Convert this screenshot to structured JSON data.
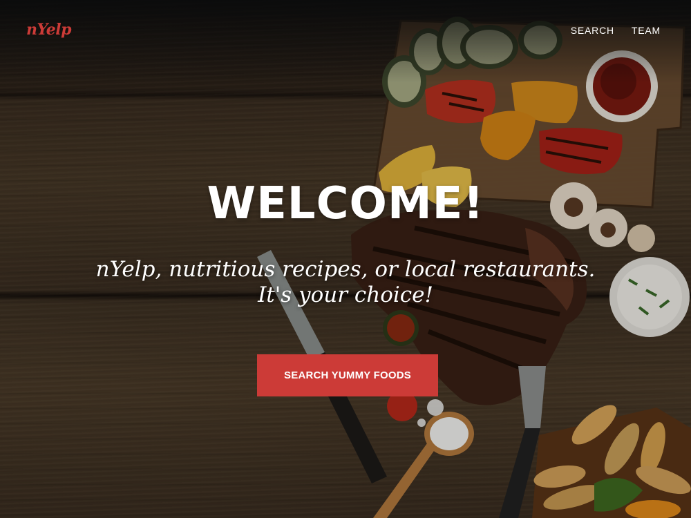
{
  "brand": {
    "logo_text": "nYelp",
    "accent_color": "#cc3b37"
  },
  "nav": {
    "items": [
      {
        "label": "SEARCH"
      },
      {
        "label": "TEAM"
      }
    ]
  },
  "hero": {
    "title": "WELCOME!",
    "subtitle_line1": "nYelp, nutritious recipes, or local restaurants.",
    "subtitle_line2": "It's your choice!",
    "cta_label": "SEARCH YUMMY FOODS",
    "background": "dark wooden table with grilled steak, vegetables, and potato wedges"
  }
}
